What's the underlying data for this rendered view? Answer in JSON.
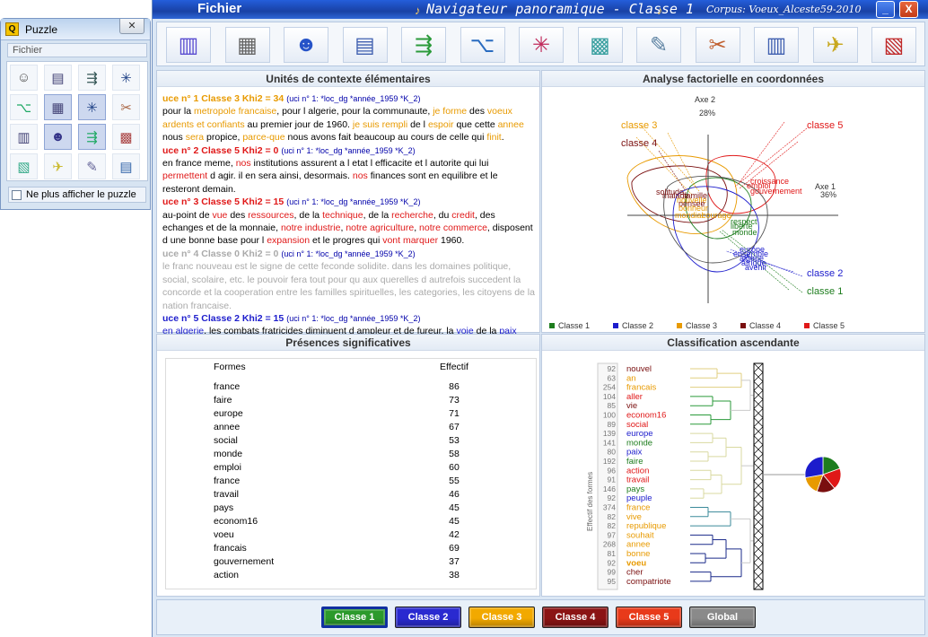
{
  "puzzle_window": {
    "title": "Puzzle",
    "close": "✕",
    "menu": "Fichier",
    "checkbox_label": "Ne plus afficher le puzzle"
  },
  "main_window": {
    "menu_file": "Fichier",
    "title": "Navigateur panoramique - Classe 1",
    "corpus": "Corpus: Voeux_Alceste59-2010",
    "minimize": "_",
    "close": "X"
  },
  "toolbar_icons": [
    "bars-chart-icon",
    "grid-tool-icon",
    "user-icon",
    "table-icon",
    "tree-icon",
    "hierarchy-icon",
    "factorial-axes-icon",
    "map-icon",
    "edit-icon",
    "network-icon",
    "calendar-icon",
    "horn-icon",
    "cube-icon"
  ],
  "panels": {
    "uce": "Unités de contexte élémentaires",
    "afc": "Analyse factorielle en coordonnées",
    "presences": "Présences significatives",
    "classification": "Classification ascendante"
  },
  "uce": [
    {
      "header": "uce n° 1  Classe 3  Khi2 = 34",
      "cls": "c3",
      "meta": "(uci n° 1:  *loc_dg *année_1959 *K_2)",
      "text": [
        [
          "pour la ",
          ""
        ],
        [
          "metropole francaise",
          ".c3"
        ],
        [
          ", pour l algerie, pour la communaute, ",
          ""
        ],
        [
          "je forme",
          ".c3"
        ],
        [
          " des ",
          ""
        ],
        [
          "voeux ardents et confiants",
          ".c3"
        ],
        [
          " au premier jour de 1960. ",
          ""
        ],
        [
          "je suis rempli",
          ".c3"
        ],
        [
          " de l ",
          ""
        ],
        [
          "espoir",
          ".c3"
        ],
        [
          " que cette ",
          ""
        ],
        [
          "annee",
          ".c3"
        ],
        [
          " nous ",
          ""
        ],
        [
          "sera",
          ".c3"
        ],
        [
          " propice, ",
          ""
        ],
        [
          "parce-que",
          ".c3"
        ],
        [
          " nous avons fait beaucoup au cours de celle qui ",
          ""
        ],
        [
          "finit",
          ".c3"
        ],
        [
          ".",
          ""
        ]
      ]
    },
    {
      "header": "uce n° 2  Classe 5  Khi2 = 0",
      "cls": "c5",
      "meta": "(uci n° 1:  *loc_dg *année_1959 *K_2)",
      "text": [
        [
          "en france meme, ",
          ""
        ],
        [
          "nos",
          ".c5"
        ],
        [
          " institutions assurent a l etat l efficacite et l autorite qui lui ",
          ""
        ],
        [
          "permettent",
          ".c5"
        ],
        [
          " d agir. il en sera ainsi, desormais. ",
          ""
        ],
        [
          "nos",
          ".c5"
        ],
        [
          " finances sont en equilibre et le resteront demain.",
          ""
        ]
      ]
    },
    {
      "header": "uce n° 3  Classe 5  Khi2 = 15",
      "cls": "c5",
      "meta": "(uci n° 1:  *loc_dg *année_1959 *K_2)",
      "text": [
        [
          "au-point de ",
          ""
        ],
        [
          "vue",
          ".c5"
        ],
        [
          " des ",
          ""
        ],
        [
          "ressources",
          ".c5"
        ],
        [
          ", de la ",
          ""
        ],
        [
          "technique",
          ".c5"
        ],
        [
          ", de la ",
          ""
        ],
        [
          "recherche",
          ".c5"
        ],
        [
          ", du ",
          ""
        ],
        [
          "credit",
          ".c5"
        ],
        [
          ", des echanges et de la monnaie, ",
          ""
        ],
        [
          "notre industrie",
          ".c5"
        ],
        [
          ", ",
          ""
        ],
        [
          "notre agriculture",
          ".c5"
        ],
        [
          ", ",
          ""
        ],
        [
          "notre commerce",
          ".c5"
        ],
        [
          ", disposent d une bonne base pour l ",
          ""
        ],
        [
          "expansion",
          ".c5"
        ],
        [
          " et le progres qui ",
          ""
        ],
        [
          "vont marquer",
          ".c5"
        ],
        [
          " 1960.",
          ""
        ]
      ]
    },
    {
      "header": "uce n° 4  Classe 0  Khi2 = 0",
      "cls": "cg",
      "meta": "(uci n° 1:  *loc_dg *année_1959 *K_2)",
      "text": [
        [
          "le franc nouveau est le signe de cette feconde solidite. dans les domaines politique, social, scolaire, etc. le pouvoir fera tout pour qu aux querelles d autrefois succedent la concorde et la cooperation entre les familles spirituelles, les categories, les citoyens de la nation francaise.",
          ".cg"
        ]
      ]
    },
    {
      "header": "uce n° 5  Classe 2  Khi2 = 15",
      "cls": "c2",
      "meta": "(uci n° 1:  *loc_dg *année_1959 *K_2)",
      "text": [
        [
          "en algerie",
          ".c2"
        ],
        [
          ", les combats fratricides diminuent d ampleur et de fureur. la ",
          ""
        ],
        [
          "voie",
          ".c2"
        ],
        [
          " de la ",
          ""
        ],
        [
          "paix",
          ".c2"
        ],
        [
          "",
          ""
        ]
      ]
    }
  ],
  "afc": {
    "axis2": "Axe 2",
    "axis2_pct": "28%",
    "axis1": "Axe 1",
    "axis1_pct": "36%",
    "class_labels": [
      {
        "t": "classe 3",
        "cls": "c3"
      },
      {
        "t": "classe 4",
        "cls": "c4"
      },
      {
        "t": "classe 5",
        "cls": "c5"
      },
      {
        "t": "classe 2",
        "cls": "c2"
      },
      {
        "t": "classe 1",
        "cls": "c1"
      }
    ],
    "words": [
      {
        "t": "solitude",
        "cls": "c4"
      },
      {
        "t": "malade",
        "cls": "c4"
      },
      {
        "t": "famille",
        "cls": "c4"
      },
      {
        "t": "nouvelle",
        "cls": "c3"
      },
      {
        "t": "pensee",
        "cls": "c4"
      },
      {
        "t": "bonheur",
        "cls": "c3"
      },
      {
        "t": "mondial",
        "cls": "c3"
      },
      {
        "t": "courage",
        "cls": "c3"
      },
      {
        "t": "croissance",
        "cls": "c5"
      },
      {
        "t": "emploi",
        "cls": "c5"
      },
      {
        "t": "gouvernement",
        "cls": "c5"
      },
      {
        "t": "respect",
        "cls": "c1"
      },
      {
        "t": "liberte",
        "cls": "c1"
      },
      {
        "t": "monde",
        "cls": "c1"
      },
      {
        "t": "europe",
        "cls": "c2"
      },
      {
        "t": "ensemble",
        "cls": "c2"
      },
      {
        "t": "algerie",
        "cls": "c2"
      },
      {
        "t": "afrique",
        "cls": "c2"
      },
      {
        "t": "avenir",
        "cls": "c2"
      }
    ],
    "legend": [
      {
        "t": "Classe 1",
        "color": "#1e7d1e"
      },
      {
        "t": "Classe 2",
        "color": "#1c1ccc"
      },
      {
        "t": "Classe 3",
        "color": "#e89a00"
      },
      {
        "t": "Classe 4",
        "color": "#7a0f0f"
      },
      {
        "t": "Classe 5",
        "color": "#e01818"
      }
    ]
  },
  "presences": {
    "col_forms": "Formes",
    "col_eff": "Effectif",
    "rows": [
      [
        "france",
        "86"
      ],
      [
        "faire",
        "73"
      ],
      [
        "europe",
        "71"
      ],
      [
        "annee",
        "67"
      ],
      [
        "social",
        "53"
      ],
      [
        "monde",
        "58"
      ],
      [
        "emploi",
        "60"
      ],
      [
        "france",
        "55"
      ],
      [
        "travail",
        "46"
      ],
      [
        "pays",
        "45"
      ],
      [
        "econom16",
        "45"
      ],
      [
        "voeu",
        "42"
      ],
      [
        "francais",
        "69"
      ],
      [
        "gouvernement",
        "37"
      ],
      [
        "action",
        "38"
      ]
    ]
  },
  "classification": {
    "side_label": "Effectif des formes",
    "rows": [
      [
        "92",
        "nouvel",
        "#7a0f0f",
        false
      ],
      [
        "63",
        "an",
        "#e89a00",
        false
      ],
      [
        "254",
        "francais",
        "#e89a00",
        false
      ],
      [
        "104",
        "aller",
        "#e01818",
        false
      ],
      [
        "85",
        "vie",
        "#7a0f0f",
        false
      ],
      [
        "100",
        "econom16",
        "#e01818",
        false
      ],
      [
        "89",
        "social",
        "#e01818",
        false
      ],
      [
        "139",
        "europe",
        "#1c1ccc",
        false
      ],
      [
        "141",
        "monde",
        "#1e7d1e",
        false
      ],
      [
        "80",
        "paix",
        "#1c1ccc",
        false
      ],
      [
        "192",
        "faire",
        "#1e7d1e",
        false
      ],
      [
        "96",
        "action",
        "#e01818",
        false
      ],
      [
        "91",
        "travail",
        "#e01818",
        false
      ],
      [
        "146",
        "pays",
        "#1e7d1e",
        false
      ],
      [
        "92",
        "peuple",
        "#1c1ccc",
        false
      ],
      [
        "374",
        "france",
        "#e89a00",
        false
      ],
      [
        "82",
        "vive",
        "#e89a00",
        false
      ],
      [
        "82",
        "republique",
        "#e89a00",
        false
      ],
      [
        "97",
        "souhait",
        "#e89a00",
        false
      ],
      [
        "268",
        "annee",
        "#e89a00",
        false
      ],
      [
        "81",
        "bonne",
        "#e89a00",
        false
      ],
      [
        "92",
        "voeu",
        "#e89a00",
        true
      ],
      [
        "99",
        "cher",
        "#7a0f0f",
        false
      ],
      [
        "95",
        "compatriote",
        "#7a0f0f",
        false
      ]
    ]
  },
  "class_buttons": [
    {
      "label": "Classe 1",
      "color": "#2c9a2c",
      "active": true
    },
    {
      "label": "Classe 2",
      "color": "#2a2ad0",
      "active": false
    },
    {
      "label": "Classe 3",
      "color": "#f2a900",
      "active": false
    },
    {
      "label": "Classe 4",
      "color": "#8b1414",
      "active": false
    },
    {
      "label": "Classe 5",
      "color": "#e83a1a",
      "active": false
    },
    {
      "label": "Global",
      "color": "#8a8a8a",
      "active": false
    }
  ]
}
